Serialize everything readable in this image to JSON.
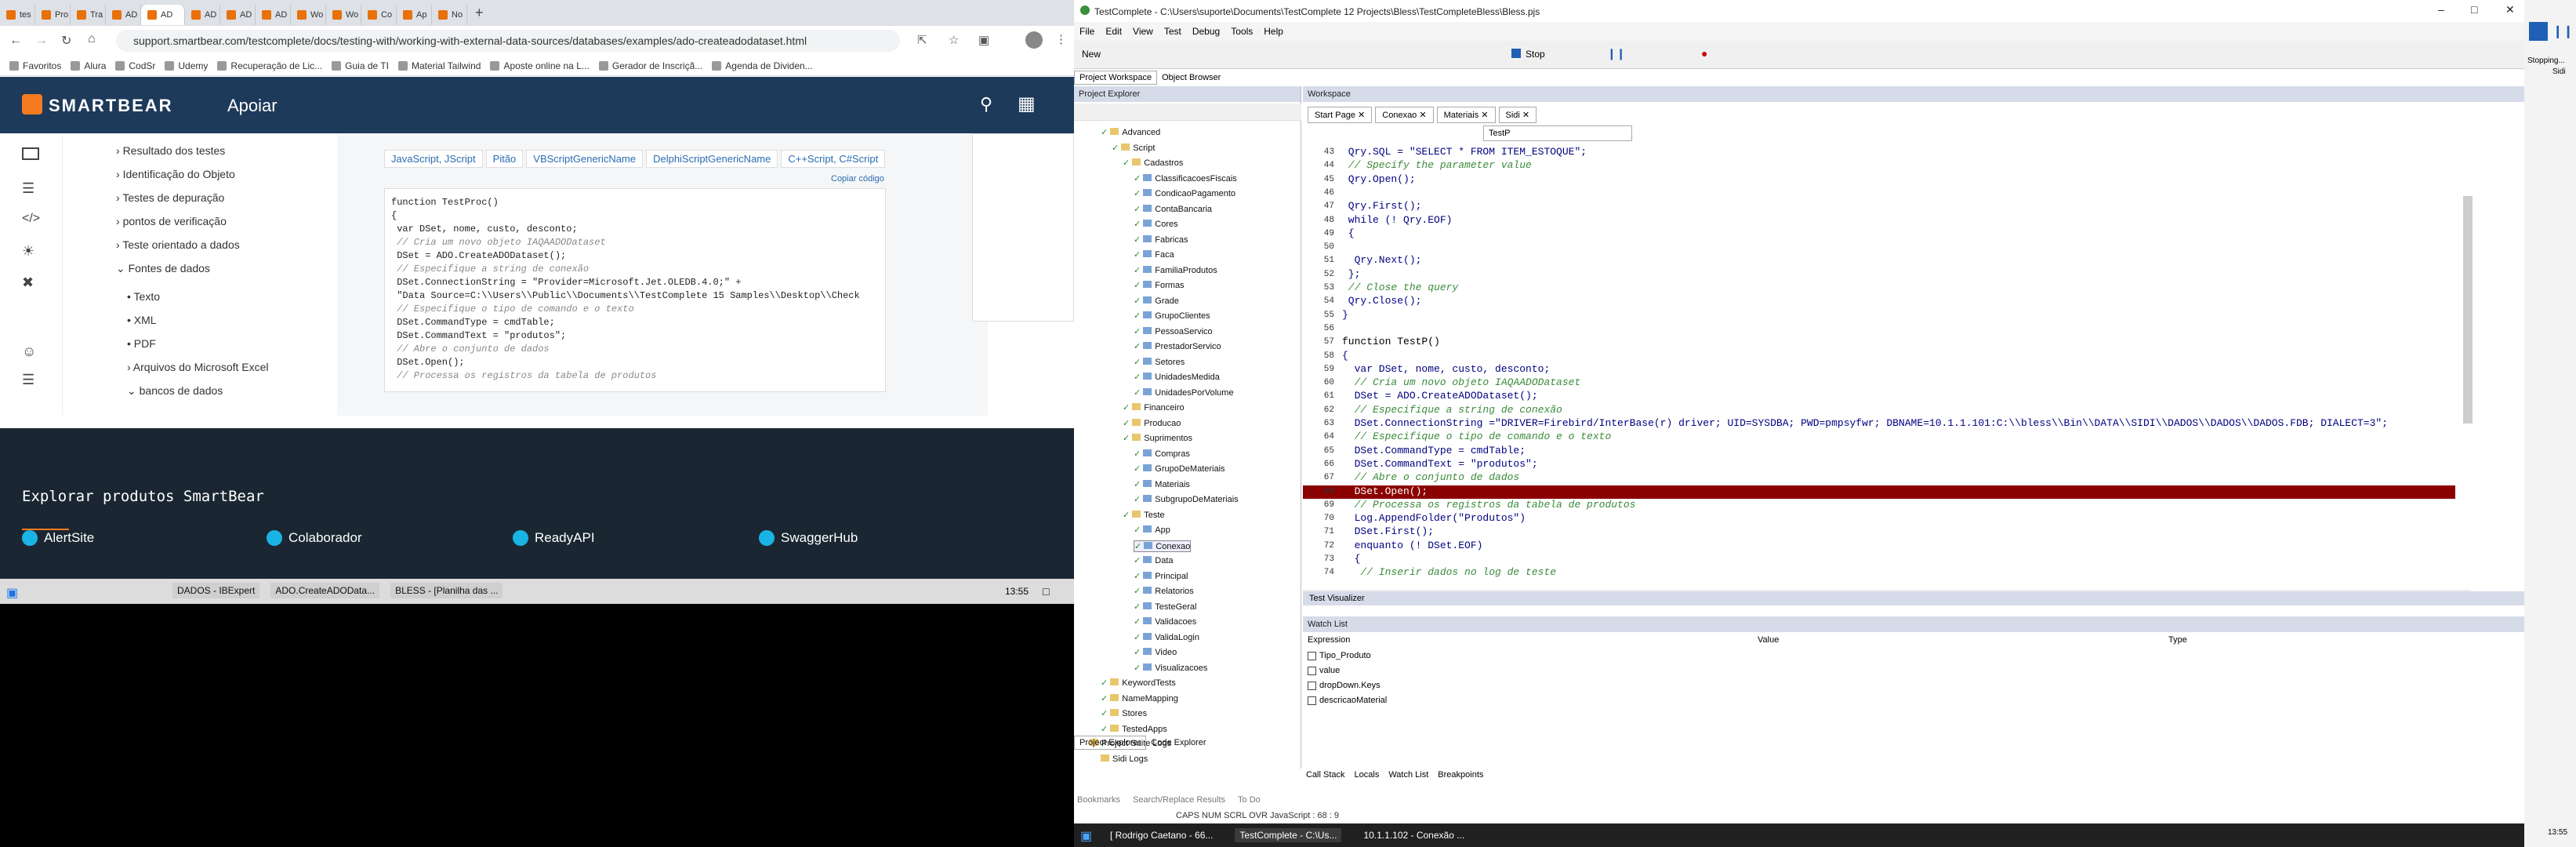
{
  "chrome": {
    "tabs": [
      "tes",
      "Pro",
      "Tra",
      "AD",
      "AD",
      "AD",
      "AD",
      "AD",
      "Wo",
      "Wo",
      "Co",
      "Ap",
      "No"
    ],
    "url": "support.smartbear.com/testcomplete/docs/testing-with/working-with-external-data-sources/databases/examples/ado-createadodataset.html",
    "bookmarks": [
      "Favoritos",
      "Alura",
      "CodSr",
      "Udemy",
      "Recuperação de Lic...",
      "Guia de TI",
      "Material Tailwind",
      "Aposte online na L...",
      "Gerador de Inscriçã...",
      "Agenda de Dividen..."
    ]
  },
  "smartbear": {
    "brand": "SMARTBEAR",
    "section": "Apoiar",
    "nav": [
      "Resultado dos testes",
      "Identificação do Objeto",
      "Testes de depuração",
      "pontos de verificação",
      "Teste orientado a dados",
      "Fontes de dados",
      "Texto",
      "XML",
      "PDF",
      "Arquivos do Microsoft Excel",
      "bancos de dados"
    ],
    "langtabs": [
      "JavaScript, JScript",
      "Pitão",
      "VBScriptGenericName",
      "DelphiScriptGenericName",
      "C++Script, C#Script"
    ],
    "copy": "Copiar código",
    "code": [
      "function TestProc()",
      "{",
      " var DSet, nome, custo, desconto;",
      " // Cria um novo objeto IAQAADODataset",
      " DSet = ADO.CreateADODataset();",
      " // Especifique a string de conexão",
      " DSet.ConnectionString = \"Provider=Microsoft.Jet.OLEDB.4.0;\" +",
      " \"Data Source=C:\\\\Users\\\\Public\\\\Documents\\\\TestComplete 15 Samples\\\\Desktop\\\\Check",
      " // Especifique o tipo de comando e o texto",
      " DSet.CommandType = cmdTable;",
      " DSet.CommandText = \"produtos\";",
      " // Abre o conjunto de dados",
      " DSet.Open();",
      " // Processa os registros da tabela de produtos"
    ],
    "explore": "Explorar produtos SmartBear",
    "products": [
      "AlertSite",
      "Colaborador",
      "ReadyAPI",
      "SwaggerHub"
    ]
  },
  "taskbar1": {
    "items": [
      "DADOS - IBExpert",
      "ADO.CreateADOData...",
      "BLESS - [Planilha das ..."
    ],
    "time": "13:55"
  },
  "tc": {
    "title": "TestComplete - C:\\Users\\suporte\\Documents\\TestComplete 12 Projects\\Bless\\TestCompleteBless\\Bless.pjs",
    "menu": [
      "File",
      "Edit",
      "View",
      "Test",
      "Debug",
      "Tools",
      "Help"
    ],
    "new": "New",
    "stop": "Stop",
    "wstabs": [
      "Project Workspace",
      "Object Browser"
    ],
    "pe": "Project Explorer",
    "workspace": "Workspace",
    "doctabs": [
      "Start Page",
      "Conexao",
      "Materiais",
      "Sidi"
    ],
    "routine": "TestP",
    "tree": [
      "Advanced",
      "Script",
      "Cadastros",
      "ClassificacoesFiscais",
      "CondicaoPagamento",
      "ContaBancaria",
      "Cores",
      "Fabricas",
      "Faca",
      "FamiliaProdutos",
      "Formas",
      "Grade",
      "GrupoClientes",
      "PessoaServico",
      "PrestadorServico",
      "Setores",
      "UnidadesMedida",
      "UnidadesPorVolume",
      "Financeiro",
      "Producao",
      "Suprimentos",
      "Compras",
      "GrupoDeMateriais",
      "Materiais",
      "SubgrupoDeMateriais",
      "Teste",
      "App",
      "Conexao",
      "Data",
      "Principal",
      "Relatorios",
      "TesteGeral",
      "Validacoes",
      "ValidaLogin",
      "Video",
      "Visualizacoes",
      "KeywordTests",
      "NameMapping",
      "Stores",
      "TestedApps",
      "Project Suite Logs",
      "Sidi Logs"
    ],
    "lines": [
      [
        "43",
        " Qry.SQL = \"SELECT * FROM ITEM_ESTOQUE\";"
      ],
      [
        "44",
        " // Specify the parameter value"
      ],
      [
        "45",
        " Qry.Open();"
      ],
      [
        "46",
        ""
      ],
      [
        "47",
        " Qry.First();"
      ],
      [
        "48",
        " while (! Qry.EOF)"
      ],
      [
        "49",
        " {"
      ],
      [
        "50",
        ""
      ],
      [
        "51",
        "  Qry.Next();"
      ],
      [
        "52",
        " };"
      ],
      [
        "53",
        " // Close the query"
      ],
      [
        "54",
        " Qry.Close();"
      ],
      [
        "55",
        "}"
      ],
      [
        "56",
        ""
      ],
      [
        "57",
        "function TestP()"
      ],
      [
        "58",
        "{"
      ],
      [
        "59",
        "  var DSet, nome, custo, desconto;"
      ],
      [
        "60",
        "  // Cria um novo objeto IAQAADODataset"
      ],
      [
        "61",
        "  DSet = ADO.CreateADODataset();"
      ],
      [
        "62",
        "  // Especifique a string de conexão"
      ],
      [
        "63",
        "  DSet.ConnectionString =\"DRIVER=Firebird/InterBase(r) driver; UID=SYSDBA; PWD=pmpsyfwr; DBNAME=10.1.1.101:C:\\\\bless\\\\Bin\\\\DATA\\\\SIDI\\\\DADOS\\\\DADOS\\\\DADOS.FDB; DIALECT=3\";"
      ],
      [
        "64",
        "  // Especifique o tipo de comando e o texto"
      ],
      [
        "65",
        "  DSet.CommandType = cmdTable;"
      ],
      [
        "66",
        "  DSet.CommandText = \"produtos\";"
      ],
      [
        "67",
        "  // Abre o conjunto de dados"
      ],
      [
        "68",
        "  DSet.Open();"
      ],
      [
        "69",
        "  // Processa os registros da tabela de produtos"
      ],
      [
        "70",
        "  Log.AppendFolder(\"Produtos\")"
      ],
      [
        "71",
        "  DSet.First();"
      ],
      [
        "72",
        "  enquanto (! DSet.EOF)"
      ],
      [
        "73",
        "  {"
      ],
      [
        "74",
        "   // Inserir dados no log de teste"
      ]
    ],
    "tv": "Test Visualizer",
    "watch": "Watch List",
    "wcols": [
      "Expression",
      "Value",
      "Type"
    ],
    "watches": [
      "Tipo_Produto",
      "value",
      "dropDown.Keys",
      "descricaoMaterial"
    ],
    "bottomtabs": [
      "Call Stack",
      "Locals",
      "Watch List",
      "Breakpoints"
    ],
    "petabs": [
      "Project Explorer",
      "Code Explorer"
    ],
    "logtabs": [
      "Bookmarks",
      "Search/Replace Results",
      "To Do"
    ],
    "status": "CAPS  NUM  SCRL  OVR  JavaScript : 68 : 9",
    "taskbar": [
      "[ Rodrigo Caetano - 66...",
      "TestComplete - C:\\Us...",
      "10.1.1.102 - Conexão ..."
    ],
    "time": "13:55"
  },
  "side": {
    "stopping": "Stopping...",
    "sidi": "Sidi"
  }
}
